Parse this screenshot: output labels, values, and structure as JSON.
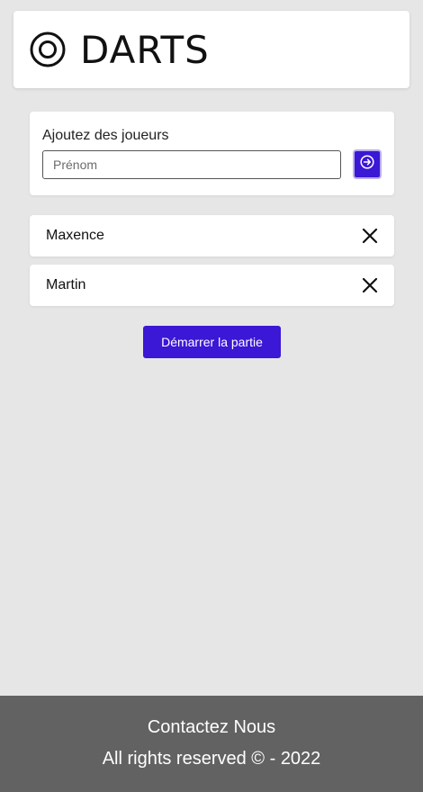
{
  "header": {
    "title": "DARTS",
    "logo_icon": "target-icon"
  },
  "add_player": {
    "label": "Ajoutez des joueurs",
    "input_placeholder": "Prénom",
    "input_value": "",
    "submit_icon": "arrow-right-circle-icon"
  },
  "players": [
    {
      "name": "Maxence",
      "remove_icon": "close-icon"
    },
    {
      "name": "Martin",
      "remove_icon": "close-icon"
    }
  ],
  "start_button": {
    "label": "Démarrer la partie"
  },
  "footer": {
    "contact": "Contactez Nous",
    "rights": "All rights reserved © - 2022"
  },
  "colors": {
    "accent": "#3b17d6",
    "background": "#e6e6e6",
    "footer": "#636262"
  }
}
